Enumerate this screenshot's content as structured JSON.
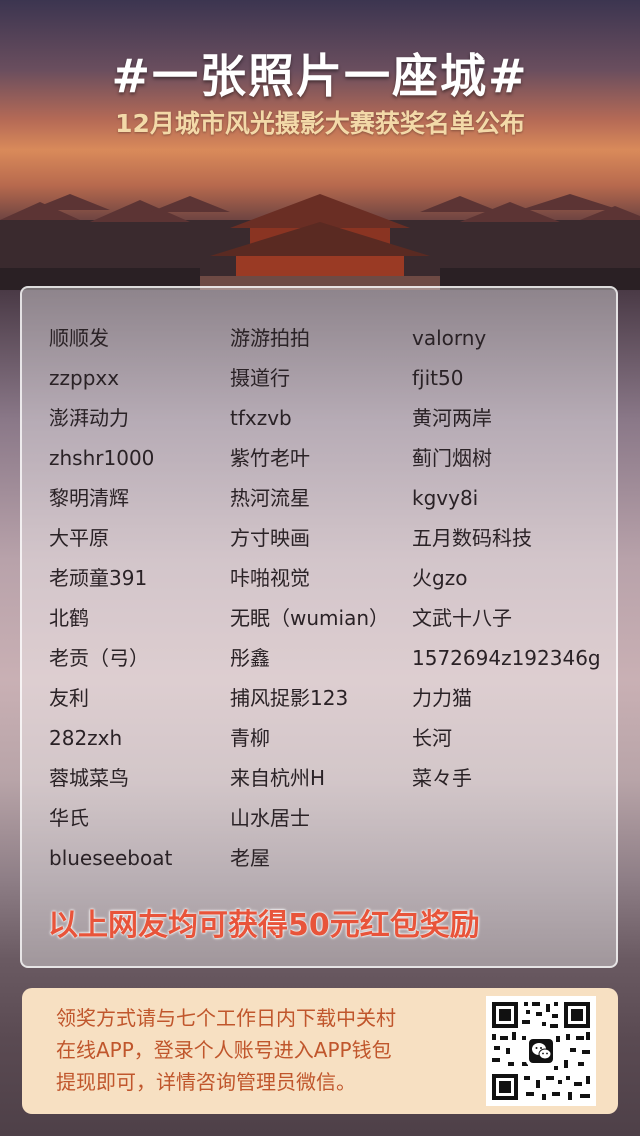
{
  "title": "#一张照片一座城#",
  "subtitle": "12月城市风光摄影大赛获奖名单公布",
  "winners": {
    "col1": [
      "顺顺发",
      "zzppxx",
      "澎湃动力",
      "zhshr1000",
      "黎明清辉",
      "大平原",
      "老顽童391",
      "北鹤",
      "老贡（弓）",
      "友利",
      "282zxh",
      "蓉城菜鸟",
      "华氏",
      "blueseeboat"
    ],
    "col2": [
      "游游拍拍",
      "摄道行",
      "tfxzvb",
      "紫竹老叶",
      "热河流星",
      "方寸映画",
      "咔啪视觉",
      "无眠（wumian）",
      "彤鑫",
      "捕风捉影123",
      "青柳",
      "来自杭州H",
      "山水居士",
      "老屋"
    ],
    "col3": [
      "valorny",
      "fjit50",
      "黄河两岸",
      "蓟门烟树",
      "kgvy8i",
      "五月数码科技",
      "火gzo",
      "文武十八子",
      "1572694z192346g",
      "力力猫",
      "长河",
      "菜々手"
    ]
  },
  "reward": "以上网友均可获得50元红包奖励",
  "info": {
    "line1": "领奖方式请与七个工作日内下载中关村",
    "line2": "在线APP，登录个人账号进入APP钱包",
    "line3": "提现即可，详情咨询管理员微信。"
  },
  "qr": {
    "icon": "wechat-icon"
  },
  "colors": {
    "reward": "#e8543a",
    "info_text": "#c0562c",
    "info_bg": "#f7e0c2"
  }
}
